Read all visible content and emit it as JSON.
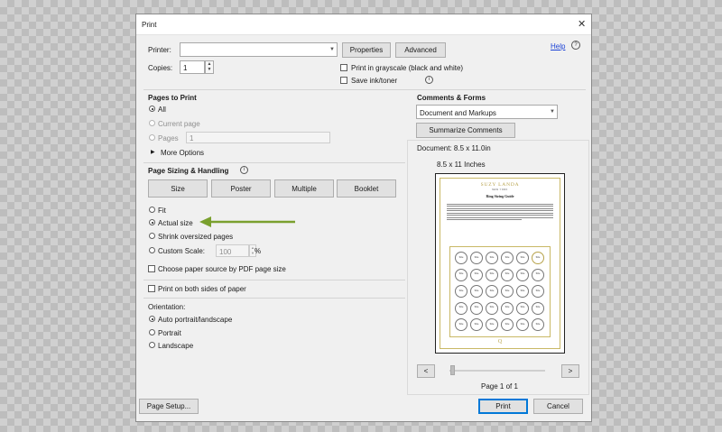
{
  "window": {
    "title": "Print",
    "close_glyph": "✕"
  },
  "top": {
    "printer_label": "Printer:",
    "printer_value": "",
    "properties_label": "Properties",
    "advanced_label": "Advanced",
    "help_label": "Help",
    "copies_label": "Copies:",
    "copies_value": "1",
    "grayscale_label": "Print in grayscale (black and white)",
    "save_ink_label": "Save ink/toner"
  },
  "pages_to_print": {
    "heading": "Pages to Print",
    "all_label": "All",
    "current_page_label": "Current page",
    "pages_label": "Pages",
    "pages_value": "1",
    "more_options_label": "More Options"
  },
  "sizing": {
    "heading": "Page Sizing & Handling",
    "tabs": [
      "Size",
      "Poster",
      "Multiple",
      "Booklet"
    ],
    "fit_label": "Fit",
    "actual_size_label": "Actual size",
    "shrink_label": "Shrink oversized pages",
    "custom_scale_label": "Custom Scale:",
    "custom_scale_value": "100",
    "percent_label": "%",
    "paper_source_label": "Choose paper source by PDF page size",
    "accent_color": "#7aa02e"
  },
  "both_sides_label": "Print on both sides of paper",
  "orientation": {
    "label": "Orientation:",
    "auto_label": "Auto portrait/landscape",
    "portrait_label": "Portrait",
    "landscape_label": "Landscape"
  },
  "comments": {
    "heading": "Comments & Forms",
    "select_value": "Document and Markups",
    "summarize_label": "Summarize Comments"
  },
  "preview": {
    "document_size": "Document: 8.5 x 11.0in",
    "sheet_size": "8.5 x 11 Inches",
    "brand_name": "SUZY LANDA",
    "brand_city": "NEW YORK",
    "guide_title": "Ring Sizing Guide",
    "monogram": "Q",
    "page_indicator": "Page 1 of 1",
    "prev_glyph": "<",
    "next_glyph": ">",
    "gold_color": "#c9b865"
  },
  "footer": {
    "page_setup_label": "Page Setup...",
    "print_label": "Print",
    "cancel_label": "Cancel"
  }
}
